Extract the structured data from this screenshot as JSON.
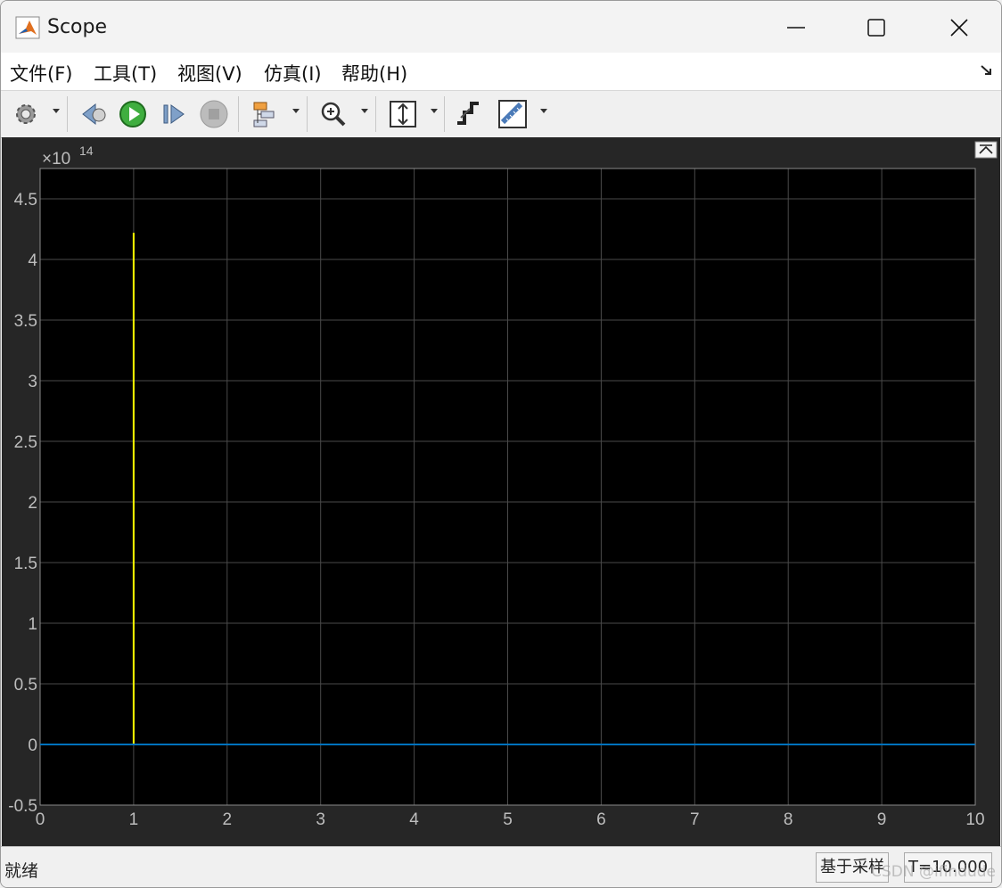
{
  "window": {
    "title": "Scope"
  },
  "menu": [
    {
      "label": "文件(F)"
    },
    {
      "label": "工具(T)"
    },
    {
      "label": "视图(V)"
    },
    {
      "label": "仿真(I)"
    },
    {
      "label": "帮助(H)"
    }
  ],
  "toolbar": {
    "icons": [
      "settings-icon",
      "step-back-icon",
      "run-icon",
      "step-forward-icon",
      "stop-icon",
      "highlight-block-icon",
      "zoom-in-icon",
      "scale-axes-icon",
      "triggers-icon",
      "cursor-measurements-icon"
    ]
  },
  "chart_data": {
    "type": "line",
    "exponent_label": "×10",
    "exponent": "14",
    "xlim": [
      0,
      10
    ],
    "ylim": [
      -0.5,
      4.75
    ],
    "x_ticks": [
      "0",
      "1",
      "2",
      "3",
      "4",
      "5",
      "6",
      "7",
      "8",
      "9",
      "10"
    ],
    "y_ticks": [
      "-0.5",
      "0",
      "0.5",
      "1",
      "1.5",
      "2",
      "2.5",
      "3",
      "3.5",
      "4",
      "4.5"
    ],
    "x_tick_values": [
      0,
      1,
      2,
      3,
      4,
      5,
      6,
      7,
      8,
      9,
      10
    ],
    "y_tick_values": [
      -0.5,
      0,
      0.5,
      1,
      1.5,
      2,
      2.5,
      3,
      3.5,
      4,
      4.5
    ],
    "grid": true,
    "series": [
      {
        "color": "#FFFF00",
        "points": [
          [
            1,
            0
          ],
          [
            1,
            4.22
          ],
          [
            1,
            0
          ]
        ]
      },
      {
        "color": "#0072BD",
        "points": [
          [
            0,
            0
          ],
          [
            10,
            0
          ]
        ]
      }
    ]
  },
  "status": {
    "text": "就绪",
    "mode": "基于采样",
    "time": "T=10.000",
    "watermark": "CSDN @ifindude"
  }
}
